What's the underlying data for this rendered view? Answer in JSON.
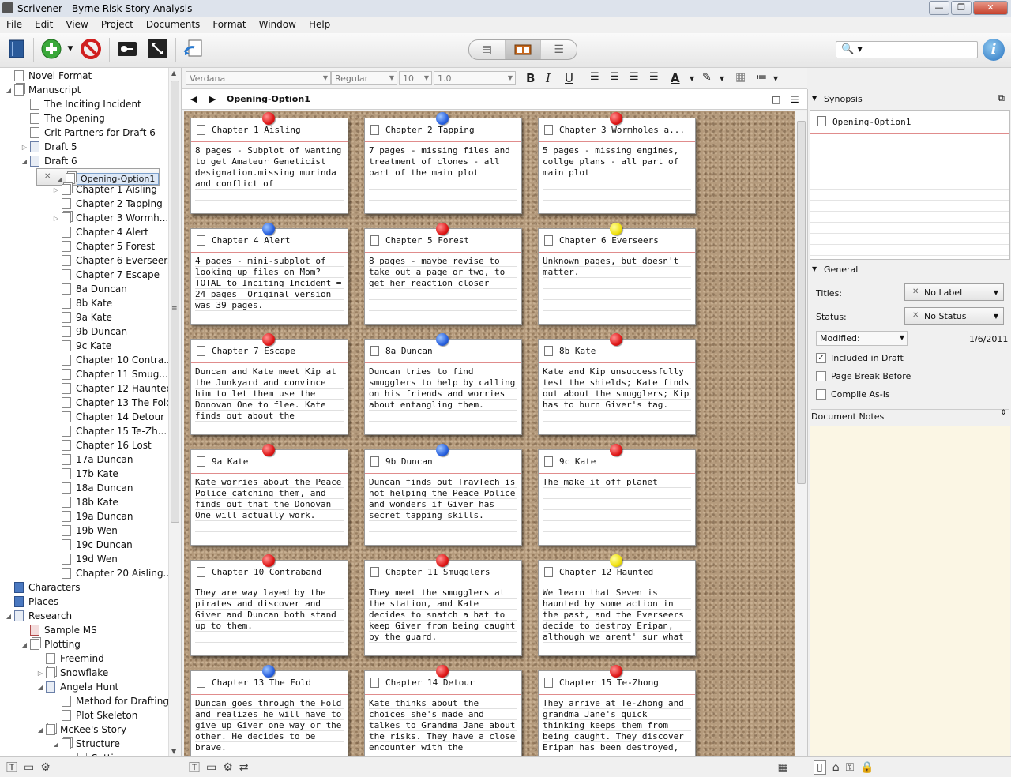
{
  "window": {
    "title": "Scrivener - Byrne Risk Story Analysis",
    "min": "—",
    "max": "❐",
    "close": "✕"
  },
  "menu": [
    "File",
    "Edit",
    "View",
    "Project",
    "Documents",
    "Format",
    "Window",
    "Help"
  ],
  "toolbar": {
    "icons": [
      "binder-icon",
      "add-icon",
      "delete-icon",
      "keywords-icon",
      "compose-icon",
      "import-icon"
    ],
    "view_modes": [
      "document-view-icon",
      "corkboard-view-icon",
      "outliner-view-icon"
    ],
    "search_placeholder": "",
    "search_icon": "🔍",
    "info_icon": "i"
  },
  "binder": {
    "items": [
      {
        "label": "Novel Format",
        "level": 0,
        "expand": "",
        "icon": "doc"
      },
      {
        "label": "Manuscript",
        "level": 0,
        "expand": "◢",
        "icon": "stack"
      },
      {
        "label": "The Inciting Incident",
        "level": 1,
        "expand": "",
        "icon": "doc"
      },
      {
        "label": "The Opening",
        "level": 1,
        "expand": "",
        "icon": "doc"
      },
      {
        "label": "Crit Partners for Draft 6",
        "level": 1,
        "expand": "",
        "icon": "doc"
      },
      {
        "label": "Draft 5",
        "level": 1,
        "expand": "▷",
        "icon": "folder"
      },
      {
        "label": "Draft 6",
        "level": 1,
        "expand": "◢",
        "icon": "folder"
      },
      {
        "label": "Opening-Option1",
        "level": 2,
        "expand": "◢",
        "icon": "stack",
        "selected": true
      },
      {
        "label": "Chapter 1 Aisling",
        "level": 3,
        "expand": "▷",
        "icon": "stack"
      },
      {
        "label": "Chapter 2 Tapping",
        "level": 3,
        "expand": "",
        "icon": "doc"
      },
      {
        "label": "Chapter 3 Wormh...",
        "level": 3,
        "expand": "▷",
        "icon": "stack"
      },
      {
        "label": "Chapter 4 Alert",
        "level": 3,
        "expand": "",
        "icon": "doc"
      },
      {
        "label": "Chapter 5 Forest",
        "level": 3,
        "expand": "",
        "icon": "doc"
      },
      {
        "label": "Chapter 6 Everseers",
        "level": 3,
        "expand": "",
        "icon": "doc"
      },
      {
        "label": "Chapter 7 Escape",
        "level": 3,
        "expand": "",
        "icon": "doc"
      },
      {
        "label": "8a Duncan",
        "level": 3,
        "expand": "",
        "icon": "doc"
      },
      {
        "label": "8b Kate",
        "level": 3,
        "expand": "",
        "icon": "doc"
      },
      {
        "label": "9a Kate",
        "level": 3,
        "expand": "",
        "icon": "doc"
      },
      {
        "label": "9b Duncan",
        "level": 3,
        "expand": "",
        "icon": "doc"
      },
      {
        "label": "9c Kate",
        "level": 3,
        "expand": "",
        "icon": "doc"
      },
      {
        "label": "Chapter 10 Contra...",
        "level": 3,
        "expand": "",
        "icon": "doc"
      },
      {
        "label": "Chapter 11 Smug...",
        "level": 3,
        "expand": "",
        "icon": "doc"
      },
      {
        "label": "Chapter 12 Haunted",
        "level": 3,
        "expand": "",
        "icon": "doc"
      },
      {
        "label": "Chapter 13 The Fold",
        "level": 3,
        "expand": "",
        "icon": "doc"
      },
      {
        "label": "Chapter 14 Detour",
        "level": 3,
        "expand": "",
        "icon": "doc"
      },
      {
        "label": "Chapter 15 Te-Zh...",
        "level": 3,
        "expand": "",
        "icon": "doc"
      },
      {
        "label": "Chapter 16 Lost",
        "level": 3,
        "expand": "",
        "icon": "doc"
      },
      {
        "label": "17a Duncan",
        "level": 3,
        "expand": "",
        "icon": "doc"
      },
      {
        "label": "17b Kate",
        "level": 3,
        "expand": "",
        "icon": "doc"
      },
      {
        "label": "18a Duncan",
        "level": 3,
        "expand": "",
        "icon": "doc"
      },
      {
        "label": "18b Kate",
        "level": 3,
        "expand": "",
        "icon": "doc"
      },
      {
        "label": "19a Duncan",
        "level": 3,
        "expand": "",
        "icon": "doc"
      },
      {
        "label": "19b Wen",
        "level": 3,
        "expand": "",
        "icon": "doc"
      },
      {
        "label": "19c Duncan",
        "level": 3,
        "expand": "",
        "icon": "doc"
      },
      {
        "label": "19d Wen",
        "level": 3,
        "expand": "",
        "icon": "doc"
      },
      {
        "label": "Chapter 20 Aisling...",
        "level": 3,
        "expand": "",
        "icon": "doc"
      },
      {
        "label": "Characters",
        "level": 0,
        "expand": "",
        "icon": "blue"
      },
      {
        "label": "Places",
        "level": 0,
        "expand": "",
        "icon": "blue"
      },
      {
        "label": "Research",
        "level": 0,
        "expand": "◢",
        "icon": "folder"
      },
      {
        "label": "Sample MS",
        "level": 1,
        "expand": "",
        "icon": "red"
      },
      {
        "label": "Plotting",
        "level": 1,
        "expand": "◢",
        "icon": "stack"
      },
      {
        "label": "Freemind",
        "level": 2,
        "expand": "",
        "icon": "doc"
      },
      {
        "label": "Snowflake",
        "level": 2,
        "expand": "▷",
        "icon": "stack"
      },
      {
        "label": "Angela Hunt",
        "level": 2,
        "expand": "◢",
        "icon": "folder"
      },
      {
        "label": "Method for Drafting",
        "level": 3,
        "expand": "",
        "icon": "doc"
      },
      {
        "label": "Plot Skeleton",
        "level": 3,
        "expand": "",
        "icon": "doc"
      },
      {
        "label": "McKee's Story",
        "level": 2,
        "expand": "◢",
        "icon": "stack"
      },
      {
        "label": "Structure",
        "level": 3,
        "expand": "◢",
        "icon": "stack"
      },
      {
        "label": "Setting",
        "level": 4,
        "expand": "",
        "icon": "doc"
      }
    ]
  },
  "format_bar": {
    "font": "Verdana",
    "style": "Regular",
    "size": "10",
    "spacing": "1.0",
    "bold": "B",
    "italic": "I",
    "underline": "U"
  },
  "header": {
    "back": "◀",
    "forward": "▶",
    "document": "Opening-Option1"
  },
  "cards": [
    {
      "title": "Chapter 1 Aisling",
      "pin": "red",
      "text": "8 pages - Subplot of wanting to get Amateur Geneticist designation.missing murinda and conflict of"
    },
    {
      "title": "Chapter 2 Tapping",
      "pin": "blue",
      "text": "7 pages - missing files and treatment of clones - all part of the main plot"
    },
    {
      "title": "Chapter 3 Wormholes a...",
      "pin": "red",
      "text": "5 pages - missing engines, collge plans - all part of main plot"
    },
    {
      "title": "Chapter 4 Alert",
      "pin": "blue",
      "text": "4 pages - mini-subplot of looking up files on Mom? TOTAL to Inciting Incident = 24 pages  Original version was 39 pages."
    },
    {
      "title": "Chapter 5 Forest",
      "pin": "red",
      "text": "8 pages - maybe revise to take out a page or two, to get her reaction closer"
    },
    {
      "title": "Chapter 6 Everseers",
      "pin": "yellow",
      "text": "Unknown pages, but doesn't matter."
    },
    {
      "title": "Chapter 7 Escape",
      "pin": "red",
      "text": "Duncan and Kate meet Kip at the Junkyard and convince him to let them use the Donovan One to flee. Kate finds out about the"
    },
    {
      "title": "8a Duncan",
      "pin": "blue",
      "text": "Duncan tries to find smugglers to help by calling on his friends and worries about entangling them."
    },
    {
      "title": "8b Kate",
      "pin": "red",
      "text": "Kate and Kip unsuccessfully test the shields; Kate finds out about the smugglers; Kip has to burn Giver's tag."
    },
    {
      "title": "9a Kate",
      "pin": "red",
      "text": "Kate worries about the Peace Police catching them, and finds out that the Donovan One will actually work."
    },
    {
      "title": "9b Duncan",
      "pin": "blue",
      "text": "Duncan finds out TravTech is not helping the Peace Police and wonders if Giver has secret tapping skills."
    },
    {
      "title": "9c Kate",
      "pin": "red",
      "text": "The make it off planet"
    },
    {
      "title": "Chapter 10 Contraband",
      "pin": "red",
      "text": "They are way layed by the pirates and discover and Giver and Duncan both stand up to them."
    },
    {
      "title": "Chapter 11 Smugglers",
      "pin": "red",
      "text": "They meet the smugglers at the station, and Kate decides to snatch a hat to keep Giver from being caught by the guard."
    },
    {
      "title": "Chapter 12 Haunted",
      "pin": "yellow",
      "text": "We learn that Seven is haunted by some action in the past, and the Everseers decide to destroy Eripan, although we arent' sur what"
    },
    {
      "title": "Chapter 13 The Fold",
      "pin": "blue",
      "text": "Duncan goes through the Fold and realizes he will have to give up Giver one way or the other. He decides to be brave."
    },
    {
      "title": "Chapter 14 Detour",
      "pin": "red",
      "text": "Kate thinks about the choices she's made and talkes to Grandma Jane about the risks. They have a close encounter with the"
    },
    {
      "title": "Chapter 15 Te-Zhong",
      "pin": "red",
      "text": "They arrive at Te-Zhong and grandma Jane's quick thinking keeps them from being caught. They discover Eripan has been destroyed,"
    }
  ],
  "inspector": {
    "synopsis_header": "Synopsis",
    "synopsis_title": "Opening-Option1",
    "general_header": "General",
    "titles_label": "Titles:",
    "label_value": "No Label",
    "status_label": "Status:",
    "status_value": "No Status",
    "modified_label": "Modified:",
    "modified_date": "1/6/2011",
    "included_in_draft": "Included in Draft",
    "page_break_before": "Page Break Before",
    "compile_as_is": "Compile As-Is",
    "document_notes": "Document Notes"
  },
  "pin_colors": {
    "red": "#e01818",
    "blue": "#2a62e0",
    "yellow": "#f0e010"
  },
  "cork_color": "#b49a7c"
}
